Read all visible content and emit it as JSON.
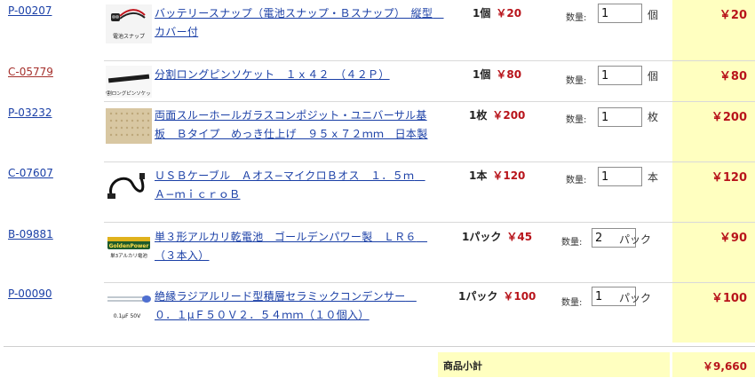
{
  "items": [
    {
      "code": "P-00207",
      "name": "バッテリースナップ（電池スナップ・Ｂスナップ）　縦型　カバー付",
      "qty_unit": "1個",
      "unit_price": "￥20",
      "qty_label": "数量:",
      "qty": "1",
      "unit": "個",
      "total": "￥20",
      "thumb_caption": "電池スナップ"
    },
    {
      "code": "C-05779",
      "name": "分割ロングピンソケット　１ｘ４２　（４２Ｐ）",
      "qty_unit": "1個",
      "unit_price": "￥80",
      "qty_label": "数量:",
      "qty": "1",
      "unit": "個",
      "total": "￥80",
      "thumb_caption": "分割ロングピンソケット"
    },
    {
      "code": "P-03232",
      "name": "両面スルーホールガラスコンポジット・ユニバーサル基板　Ｂタイプ　めっき仕上げ　９５ｘ７２ｍｍ　日本製",
      "qty_unit": "1枚",
      "unit_price": "￥200",
      "qty_label": "数量:",
      "qty": "1",
      "unit": "枚",
      "total": "￥200"
    },
    {
      "code": "C-07607",
      "name": "ＵＳＢケーブル　Ａオス−マイクロＢオス　１．５ｍ　Ａ−ｍｉｃｒｏＢ",
      "qty_unit": "1本",
      "unit_price": "￥120",
      "qty_label": "数量:",
      "qty": "1",
      "unit": "本",
      "total": "￥120"
    },
    {
      "code": "B-09881",
      "name": "単３形アルカリ乾電池　ゴールデンパワー製　ＬＲ６　（３本入）",
      "qty_unit": "1パック",
      "unit_price": "￥45",
      "qty_label": "数量:",
      "qty": "2",
      "unit": "パック",
      "total": "￥90",
      "thumb_label": "GoldenPower",
      "thumb_caption": "単3アルカリ電池"
    },
    {
      "code": "P-00090",
      "name": "絶縁ラジアルリード型積層セラミックコンデンサー　０．１μＦ５０Ｖ２．５４ｍｍ（１０個入）",
      "qty_unit": "1パック",
      "unit_price": "￥100",
      "qty_label": "数量:",
      "qty": "1",
      "unit": "パック",
      "total": "￥100",
      "thumb_caption": "0.1μF 50V"
    }
  ],
  "subtotal": {
    "label": "商品小計",
    "value": "￥9,660"
  },
  "colors": {
    "link": "#1a3fa6",
    "visited": "#a5302c",
    "price": "#b8141b",
    "highlight": "#ffffc0"
  }
}
